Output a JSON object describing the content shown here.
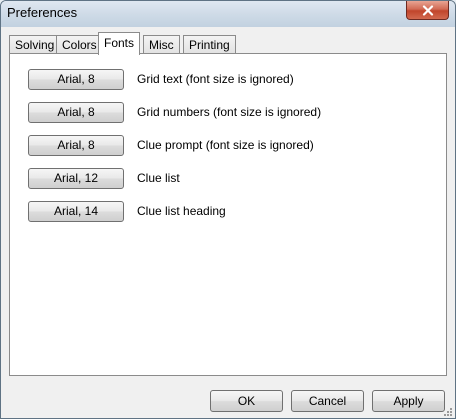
{
  "window": {
    "title": "Preferences",
    "close_icon": "close-icon"
  },
  "tabs": [
    {
      "label": "Solving",
      "active": false
    },
    {
      "label": "Colors",
      "active": false
    },
    {
      "label": "Fonts",
      "active": true
    },
    {
      "label": "Misc",
      "active": false
    },
    {
      "label": "Printing",
      "active": false
    }
  ],
  "fonts": [
    {
      "button": "Arial, 8",
      "label": "Grid text (font size is ignored)"
    },
    {
      "button": "Arial, 8",
      "label": "Grid numbers (font size is ignored)"
    },
    {
      "button": "Arial, 8",
      "label": "Clue prompt (font size is ignored)"
    },
    {
      "button": "Arial, 12",
      "label": "Clue list"
    },
    {
      "button": "Arial, 14",
      "label": "Clue list heading"
    }
  ],
  "buttons": {
    "ok": "OK",
    "cancel": "Cancel",
    "apply": "Apply"
  }
}
